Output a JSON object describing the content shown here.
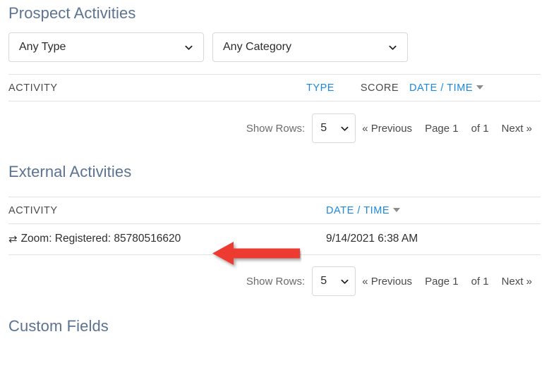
{
  "prospect_activities": {
    "title": "Prospect Activities",
    "filters": [
      {
        "name": "type",
        "value": "Any Type"
      },
      {
        "name": "category",
        "value": "Any Category"
      }
    ],
    "columns": {
      "activity": "ACTIVITY",
      "type": "TYPE",
      "score": "SCORE",
      "date_time": "DATE / TIME"
    },
    "rows": [],
    "pagination": {
      "show_rows_label": "Show Rows:",
      "rows_value": "5",
      "previous": "« Previous",
      "page": "Page 1",
      "of": "of 1",
      "next": "Next »"
    }
  },
  "external_activities": {
    "title": "External Activities",
    "columns": {
      "activity": "ACTIVITY",
      "date_time": "DATE / TIME"
    },
    "rows": [
      {
        "icon": "exchange-icon",
        "icon_glyph": "⇄",
        "activity": "Zoom: Registered: 85780516620",
        "date_time": "9/14/2021 6:38 AM"
      }
    ],
    "pagination": {
      "show_rows_label": "Show Rows:",
      "rows_value": "5",
      "previous": "« Previous",
      "page": "Page 1",
      "of": "of 1",
      "next": "Next »"
    }
  },
  "custom_fields": {
    "title": "Custom Fields"
  },
  "annotation": {
    "type": "arrow",
    "direction": "left",
    "color": "#ee3b33"
  },
  "colors": {
    "heading": "#5b7391",
    "link": "#1a88e0",
    "border": "#e2e2e2",
    "annotation_red": "#ee3b33"
  }
}
